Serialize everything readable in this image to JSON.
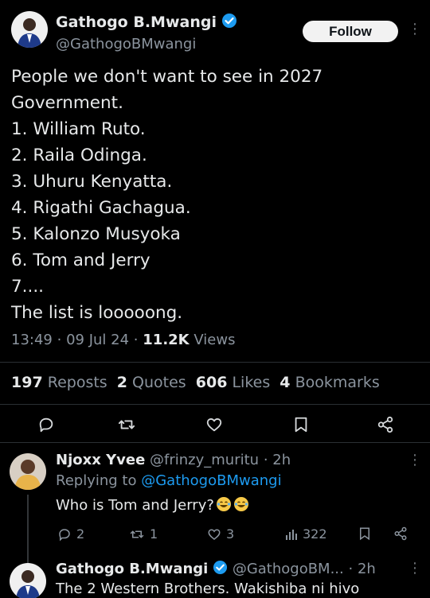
{
  "colors": {
    "background": "#000000",
    "text": "#e7e9ea",
    "muted": "#8b949e",
    "verified": "#1d9bf0",
    "mention": "#1d9bf0"
  },
  "main_tweet": {
    "author_name": "Gathogo B.Mwangi",
    "author_handle": "@GathogoBMwangi",
    "follow_label": "Follow",
    "more_icon": "more-vertical-icon",
    "lines": [
      "People we don't want to see in 2027",
      "Government.",
      "1. William Ruto.",
      "2. Raila Odinga.",
      "3. Uhuru Kenyatta.",
      "4. Rigathi Gachagua.",
      "5. Kalonzo Musyoka",
      "6. Tom and Jerry",
      "7....",
      "The list is looooong."
    ],
    "time": "13:49",
    "dot1": "·",
    "date": "09 Jul 24",
    "dot2": "·",
    "views_count": "11.2K",
    "views_label": "Views",
    "stats": {
      "reposts_count": "197",
      "reposts_label": "Reposts",
      "quotes_count": "2",
      "quotes_label": "Quotes",
      "likes_count": "606",
      "likes_label": "Likes",
      "bookmarks_count": "4",
      "bookmarks_label": "Bookmarks"
    },
    "action_icons": [
      "reply-icon",
      "repost-icon",
      "like-icon",
      "bookmark-icon",
      "share-icon"
    ]
  },
  "reply1": {
    "author_name": "Njoxx Yvee",
    "author_handle": "@frinzy_muritu",
    "separator": "·",
    "time": "2h",
    "replying_prefix": "Replying to",
    "replying_mention": "@GathogoBMwangi",
    "text": "Who is Tom and Jerry?",
    "emoji": "😂😂",
    "replies": "2",
    "reposts": "1",
    "likes": "3",
    "views": "322"
  },
  "reply2": {
    "author_name": "Gathogo B.Mwangi",
    "author_handle": "@GathogoBM...",
    "separator": "·",
    "time": "2h",
    "text": "The 2 Western Brothers. Wakishiba ni hivo"
  }
}
